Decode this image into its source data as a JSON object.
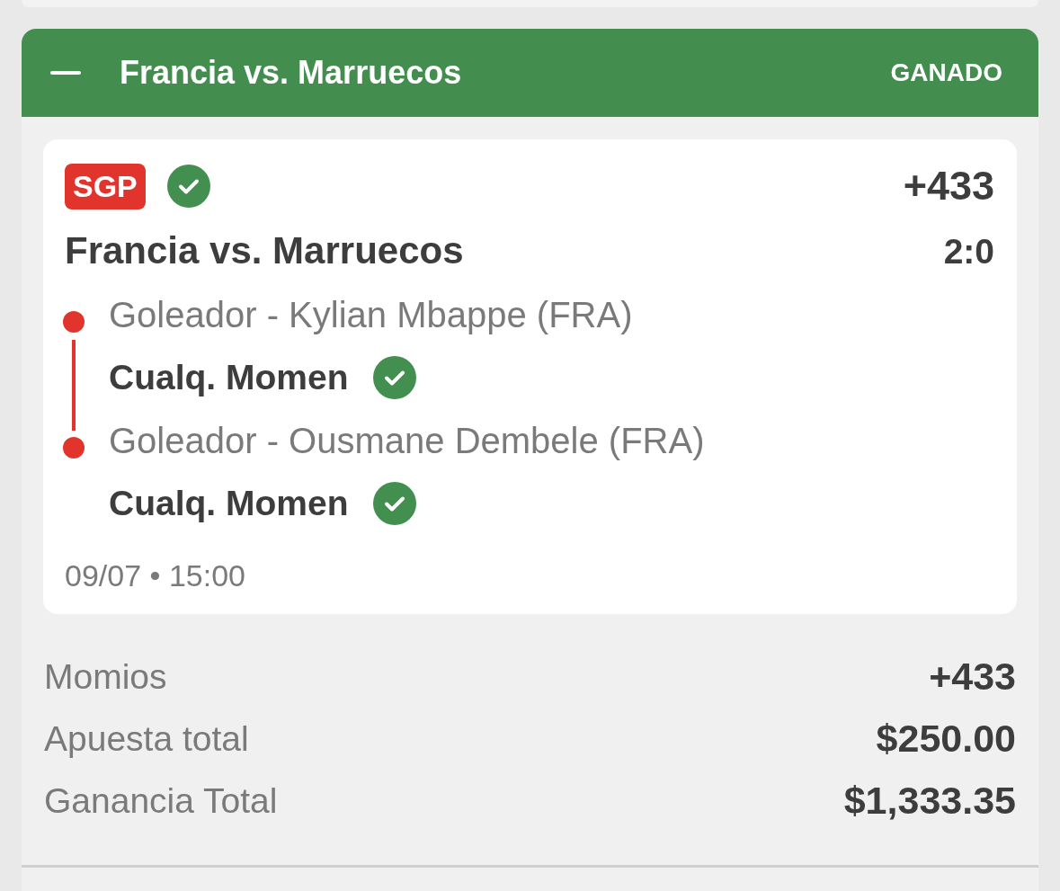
{
  "bet": {
    "expanded": true,
    "title": "Francia vs. Marruecos",
    "status": {
      "label": "GANADO",
      "kind": "won"
    }
  },
  "ticket": {
    "badge": "SGP",
    "won": true,
    "odds": "+433",
    "match": "Francia vs. Marruecos",
    "score": "2:0",
    "legs": [
      {
        "market": "Goleador - Kylian Mbappe (FRA)",
        "selection": "Cualq. Momen",
        "won": true
      },
      {
        "market": "Goleador - Ousmane Dembele (FRA)",
        "selection": "Cualq. Momen",
        "won": true
      }
    ],
    "datetime": "09/07 • 15:00"
  },
  "summary": [
    {
      "label": "Momios",
      "value": "+433"
    },
    {
      "label": "Apuesta total",
      "value": "$250.00"
    },
    {
      "label": "Ganancia Total",
      "value": "$1,333.35"
    }
  ]
}
